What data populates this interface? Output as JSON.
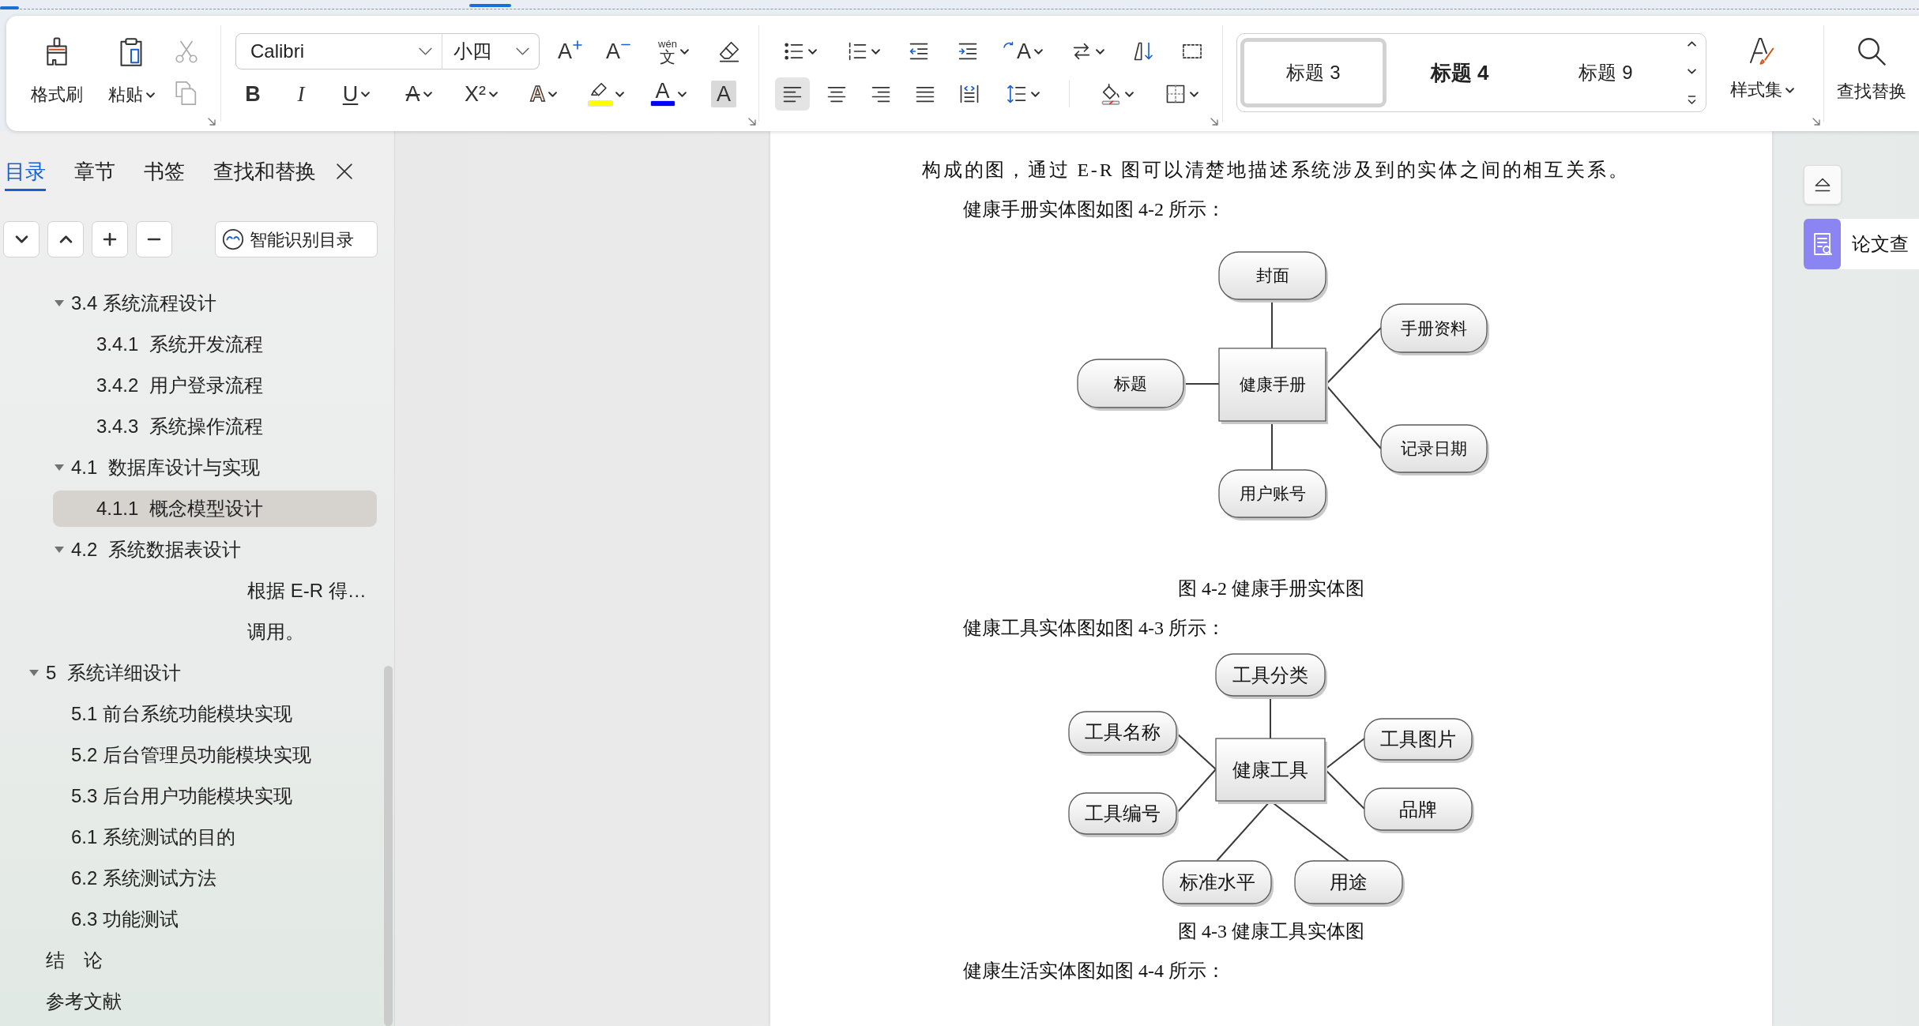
{
  "ribbon": {
    "clipboard": [
      {
        "kind": "format_painter",
        "label": "格式刷",
        "disabled": false
      },
      {
        "kind": "paste",
        "label": "粘贴",
        "disabled": false,
        "dropdown": true
      },
      {
        "kind": "cut",
        "disabled": true
      },
      {
        "kind": "copy",
        "disabled": true
      }
    ],
    "font_name": "Calibri",
    "font_size": "小四",
    "font_tools": [
      [
        {
          "kind": "grow",
          "glyph": "A"
        },
        {
          "kind": "shrink",
          "glyph": "A"
        },
        {
          "kind": "phonetic",
          "ruby": "wén",
          "glyph": "文",
          "dropdown": true
        },
        {
          "kind": "clear"
        }
      ],
      [
        {
          "kind": "bold",
          "glyph": "B"
        },
        {
          "kind": "italic",
          "glyph": "I"
        },
        {
          "kind": "underline",
          "glyph": "U",
          "dropdown": true
        },
        {
          "kind": "strike",
          "glyph": "A",
          "dropdown": true
        },
        {
          "kind": "superscript",
          "glyph": "X²",
          "dropdown": true
        },
        {
          "kind": "effect",
          "glyph": "A",
          "dropdown": true
        },
        {
          "kind": "highlight",
          "color": "#ffff00",
          "dropdown": true
        },
        {
          "kind": "font_color",
          "glyph": "A",
          "color": "#0000ff",
          "dropdown": true
        },
        {
          "kind": "char_shading",
          "glyph": "A"
        }
      ]
    ],
    "paragraph_tools": [
      {
        "kind": "bullets",
        "dropdown": true
      },
      {
        "kind": "numbering",
        "dropdown": true
      },
      {
        "kind": "outdent"
      },
      {
        "kind": "indent"
      },
      {
        "kind": "text_direction",
        "glyph": "A",
        "dropdown": true
      },
      {
        "kind": "convert",
        "dropdown": true
      },
      {
        "kind": "sort"
      },
      {
        "kind": "frame"
      }
    ],
    "alignment": [
      {
        "kind": "left",
        "selected": true
      },
      {
        "kind": "center",
        "selected": false
      },
      {
        "kind": "right",
        "selected": false
      },
      {
        "kind": "justify",
        "selected": false
      },
      {
        "kind": "distributed",
        "selected": false
      }
    ],
    "spacing_tools": [
      {
        "kind": "line_spacing",
        "dropdown": true
      }
    ],
    "fill_tools": [
      {
        "kind": "shading",
        "dropdown": true
      },
      {
        "kind": "borders",
        "dropdown": true
      }
    ],
    "styles": [
      {
        "label": "标题 3",
        "selected": true,
        "bold": false
      },
      {
        "label": "标题 4",
        "selected": false,
        "bold": true
      },
      {
        "label": "标题 9",
        "selected": false,
        "bold": false
      }
    ],
    "style_set": {
      "label": "样式集",
      "dropdown": true
    },
    "find_replace": {
      "label": "查找替换"
    }
  },
  "sidebar": {
    "tabs": [
      {
        "label": "目录",
        "selected": true
      },
      {
        "label": "章节",
        "selected": false
      },
      {
        "label": "书签",
        "selected": false
      },
      {
        "label": "查找和替换",
        "selected": false
      }
    ],
    "outline_tools": [
      {
        "kind": "down"
      },
      {
        "kind": "up"
      },
      {
        "kind": "add"
      },
      {
        "kind": "remove"
      }
    ],
    "smart_toc": {
      "label": "智能识别目录"
    },
    "outline": [
      {
        "children": [
          {
            "kind": "heading",
            "label": "3.4 系统流程设计",
            "expanded": true,
            "selected": false,
            "children": [
              {
                "kind": "heading",
                "label": "3.4.1  系统开发流程",
                "selected": false
              },
              {
                "kind": "heading",
                "label": "3.4.2  用户登录流程",
                "selected": false
              },
              {
                "kind": "heading",
                "label": "3.4.3  系统操作流程",
                "selected": false
              }
            ]
          },
          {
            "kind": "heading",
            "label": "4.1  数据库设计与实现",
            "expanded": true,
            "selected": false,
            "children": [
              {
                "kind": "heading",
                "label": "4.1.1  概念模型设计",
                "selected": true
              }
            ]
          },
          {
            "kind": "heading",
            "label": "4.2  系统数据表设计",
            "expanded": true,
            "selected": false,
            "children": [
              {
                "kind": "body_text",
                "label": "根据 E-R 得…",
                "selected": false
              },
              {
                "kind": "body_text",
                "label": "调用。",
                "selected": false
              }
            ]
          }
        ]
      },
      {
        "kind": "heading",
        "label": "5  系统详细设计",
        "expanded": true,
        "selected": false,
        "children": [
          {
            "kind": "heading",
            "label": "5.1 前台系统功能模块实现",
            "selected": false
          },
          {
            "kind": "heading",
            "label": "5.2 后台管理员功能模块实现",
            "selected": false
          },
          {
            "kind": "heading",
            "label": "5.3 后台用户功能模块实现",
            "selected": false
          },
          {
            "kind": "heading",
            "label": "6.1 系统测试的目的",
            "selected": false
          },
          {
            "kind": "heading",
            "label": "6.2 系统测试方法",
            "selected": false
          },
          {
            "kind": "heading",
            "label": "6.3 功能测试",
            "selected": false
          }
        ]
      },
      {
        "kind": "heading",
        "label": "结　论",
        "selected": false
      },
      {
        "kind": "heading",
        "label": "参考文献",
        "selected": false
      }
    ]
  },
  "document": {
    "blocks": [
      {
        "kind": "continuation",
        "text": "构成的图，通过 E-R 图可以清楚地描述系统涉及到的实体之间的相互关系。"
      },
      {
        "kind": "paragraph",
        "text": "健康手册实体图如图 4-2 所示："
      },
      {
        "kind": "er_diagram",
        "entity": "健康手册",
        "attributes": [
          "封面",
          "标题",
          "手册资料",
          "记录日期",
          "用户账号"
        ]
      },
      {
        "kind": "caption",
        "text": "图 4-2 健康手册实体图"
      },
      {
        "kind": "paragraph",
        "text": "健康工具实体图如图 4-3 所示："
      },
      {
        "kind": "er_diagram",
        "entity": "健康工具",
        "attributes": [
          "工具分类",
          "工具名称",
          "工具编号",
          "工具图片",
          "品牌",
          "标准水平",
          "用途"
        ]
      },
      {
        "kind": "caption",
        "text": "图 4-3 健康工具实体图"
      },
      {
        "kind": "paragraph",
        "text": "健康生活实体图如图 4-4 所示："
      }
    ]
  },
  "side_panel": {
    "tool_label": "论文查"
  }
}
